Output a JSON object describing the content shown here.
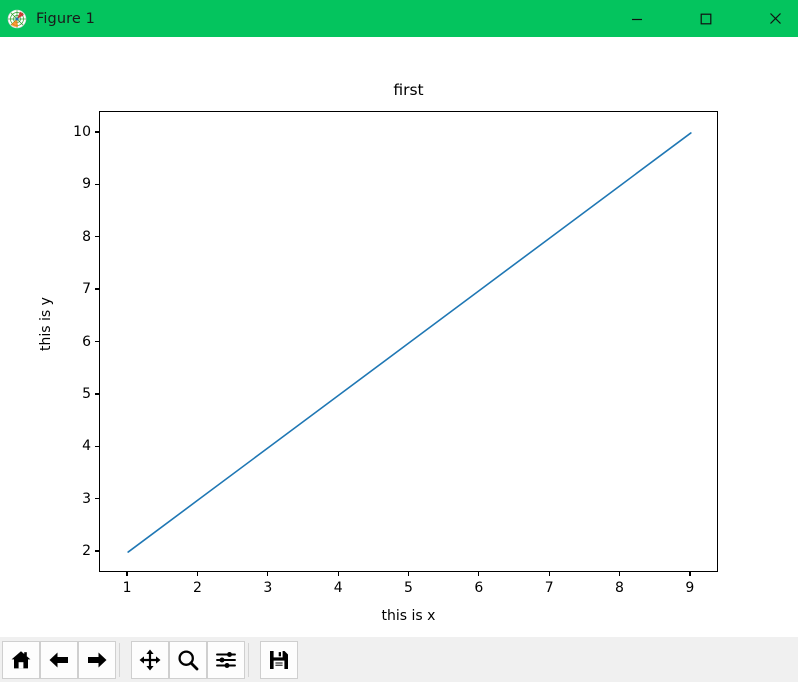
{
  "window": {
    "title": "Figure 1",
    "icon": "matplotlib-logo-icon",
    "titlebar_color": "#04c45e",
    "controls": {
      "minimize": "minimize-icon",
      "maximize": "maximize-icon",
      "close": "close-icon"
    }
  },
  "toolbar": {
    "buttons": [
      {
        "name": "home-button",
        "icon": "home-icon",
        "label": "Home"
      },
      {
        "name": "back-button",
        "icon": "arrow-left-icon",
        "label": "Back"
      },
      {
        "name": "forward-button",
        "icon": "arrow-right-icon",
        "label": "Forward"
      },
      {
        "name": "pan-button",
        "icon": "move-arrows-icon",
        "label": "Pan"
      },
      {
        "name": "zoom-button",
        "icon": "magnifier-icon",
        "label": "Zoom"
      },
      {
        "name": "configure-subplots-button",
        "icon": "sliders-icon",
        "label": "Configure subplots"
      },
      {
        "name": "save-button",
        "icon": "floppy-disk-icon",
        "label": "Save"
      }
    ]
  },
  "chart_data": {
    "type": "line",
    "title": "first",
    "xlabel": "this is x",
    "ylabel": "this is y",
    "x": [
      1,
      2,
      3,
      4,
      5,
      6,
      7,
      8,
      9
    ],
    "series": [
      {
        "name": "line",
        "color": "#1f77b4",
        "linewidth": 1.6,
        "values": [
          2,
          3,
          4,
          5,
          6,
          7,
          8,
          9,
          10
        ]
      }
    ],
    "xlim": [
      0.6,
      9.4
    ],
    "ylim": [
      1.6,
      10.4
    ],
    "xticks": [
      1,
      2,
      3,
      4,
      5,
      6,
      7,
      8,
      9
    ],
    "xticklabels": [
      "1",
      "2",
      "3",
      "4",
      "5",
      "6",
      "7",
      "8",
      "9"
    ],
    "yticks": [
      2,
      3,
      4,
      5,
      6,
      7,
      8,
      9,
      10
    ],
    "yticklabels": [
      "2",
      "3",
      "4",
      "5",
      "6",
      "7",
      "8",
      "9",
      "10"
    ],
    "grid": false,
    "legend": false,
    "background": "#ffffff"
  }
}
